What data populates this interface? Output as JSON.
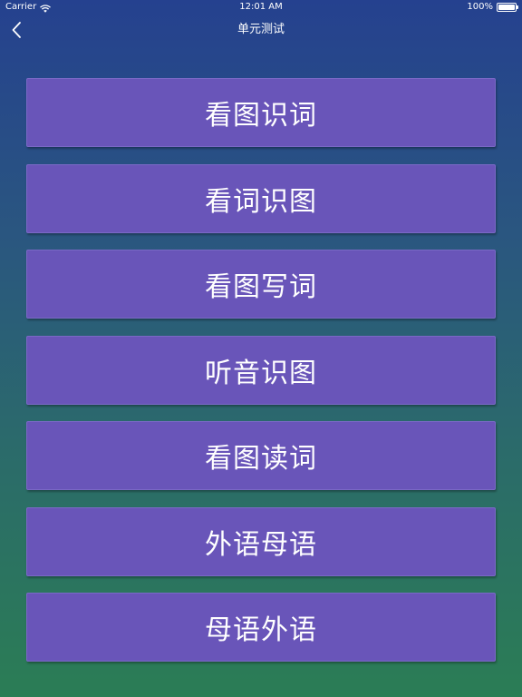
{
  "status_bar": {
    "carrier": "Carrier",
    "time": "12:01 AM",
    "battery": "100%"
  },
  "nav": {
    "title": "单元测试",
    "back_icon": "chevron-left-icon"
  },
  "menu": {
    "items": [
      {
        "label": "看图识词"
      },
      {
        "label": "看词识图"
      },
      {
        "label": "看图写词"
      },
      {
        "label": "听音识图"
      },
      {
        "label": "看图读词"
      },
      {
        "label": "外语母语"
      },
      {
        "label": "母语外语"
      }
    ]
  },
  "colors": {
    "gradient_top": "#25418f",
    "gradient_bottom": "#2b7d55",
    "button_fill": "#6955b9",
    "text": "#ffffff"
  }
}
